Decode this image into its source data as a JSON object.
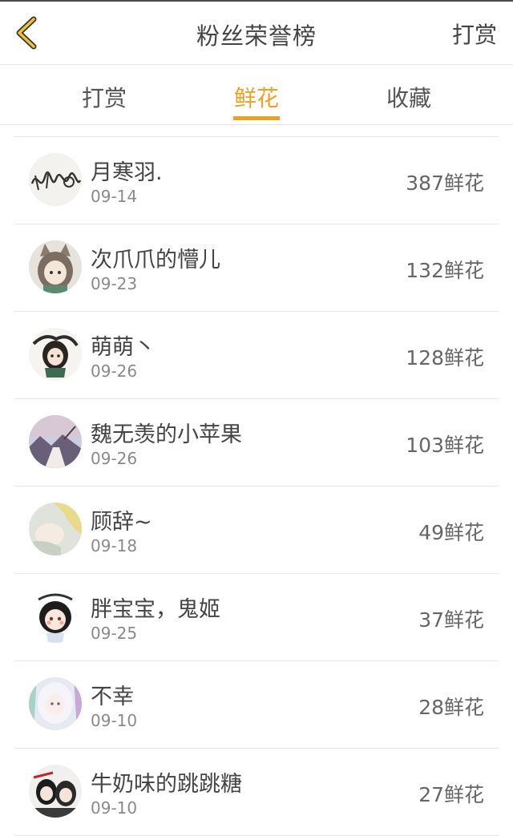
{
  "header": {
    "title": "粉丝荣誉榜",
    "action_label": "打赏",
    "accent_color": "#f0a020"
  },
  "tabs": [
    {
      "label": "打赏",
      "active": false
    },
    {
      "label": "鲜花",
      "active": true
    },
    {
      "label": "收藏",
      "active": false
    }
  ],
  "fans": [
    {
      "name": "月寒羽.",
      "date": "09-14",
      "amount": "387鲜花",
      "avatar": "signature-avatar"
    },
    {
      "name": "次爪爪的懵儿",
      "date": "09-23",
      "amount": "132鲜花",
      "avatar": "cat-girl-avatar"
    },
    {
      "name": "萌萌丶",
      "date": "09-26",
      "amount": "128鲜花",
      "avatar": "chibi-avatar"
    },
    {
      "name": "魏无羡的小苹果",
      "date": "09-26",
      "amount": "103鲜花",
      "avatar": "landscape-avatar"
    },
    {
      "name": "顾辞~",
      "date": "09-18",
      "amount": "49鲜花",
      "avatar": "blond-avatar"
    },
    {
      "name": "胖宝宝，鬼姬",
      "date": "09-25",
      "amount": "37鲜花",
      "avatar": "chibi-girl-avatar"
    },
    {
      "name": "不幸",
      "date": "09-10",
      "amount": "28鲜花",
      "avatar": "white-hair-avatar"
    },
    {
      "name": "牛奶味的跳跳糖",
      "date": "09-10",
      "amount": "27鲜花",
      "avatar": "couple-avatar"
    }
  ]
}
